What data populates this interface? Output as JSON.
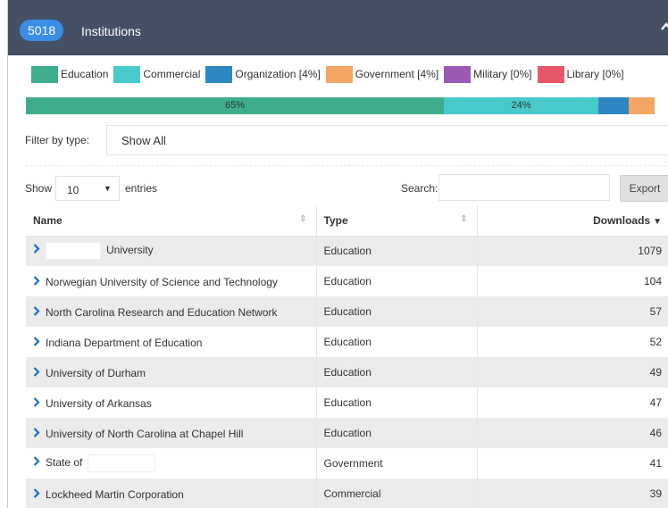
{
  "header": {
    "count": "5018",
    "title": "Institutions"
  },
  "legend": [
    {
      "label": "Education",
      "color": "#3ead8d"
    },
    {
      "label": "Commercial",
      "color": "#48c9cb"
    },
    {
      "label": "Organization [4%]",
      "color": "#2f86c3"
    },
    {
      "label": "Government [4%]",
      "color": "#f4a563"
    },
    {
      "label": "Military [0%]",
      "color": "#9b59b6"
    },
    {
      "label": "Library [0%]",
      "color": "#e8566a"
    }
  ],
  "type_bar": [
    {
      "type": "Education",
      "fraction": 0.65,
      "label": "65%",
      "color": "#3ead8d"
    },
    {
      "type": "Commercial",
      "fraction": 0.24,
      "label": "24%",
      "color": "#48c9cb"
    },
    {
      "type": "Organization",
      "fraction": 0.047,
      "label": "",
      "color": "#2f86c3"
    },
    {
      "type": "Government",
      "fraction": 0.04,
      "label": "",
      "color": "#f4a563"
    }
  ],
  "filter": {
    "label": "Filter by type:",
    "value": "Show All"
  },
  "controls": {
    "show_label": "Show",
    "entries_value": "10",
    "entries_label": "entries",
    "search_label": "Search:",
    "export_label": "Export"
  },
  "table": {
    "columns": [
      "Name",
      "Type",
      "Downloads"
    ],
    "rows": [
      {
        "name": "University",
        "redacted_prefix": true,
        "type": "Education",
        "downloads": "1079"
      },
      {
        "name": "Norwegian University of Science and Technology",
        "type": "Education",
        "downloads": "104"
      },
      {
        "name": "North Carolina Research and Education Network",
        "type": "Education",
        "downloads": "57"
      },
      {
        "name": "Indiana Department of Education",
        "type": "Education",
        "downloads": "52"
      },
      {
        "name": "University of Durham",
        "type": "Education",
        "downloads": "49"
      },
      {
        "name": "University of Arkansas",
        "type": "Education",
        "downloads": "47"
      },
      {
        "name": "University of North Carolina at Chapel Hill",
        "type": "Education",
        "downloads": "46"
      },
      {
        "name": "State of",
        "redacted_suffix": true,
        "type": "Government",
        "downloads": "41"
      },
      {
        "name": "Lockheed Martin Corporation",
        "type": "Commercial",
        "downloads": "39"
      }
    ]
  }
}
